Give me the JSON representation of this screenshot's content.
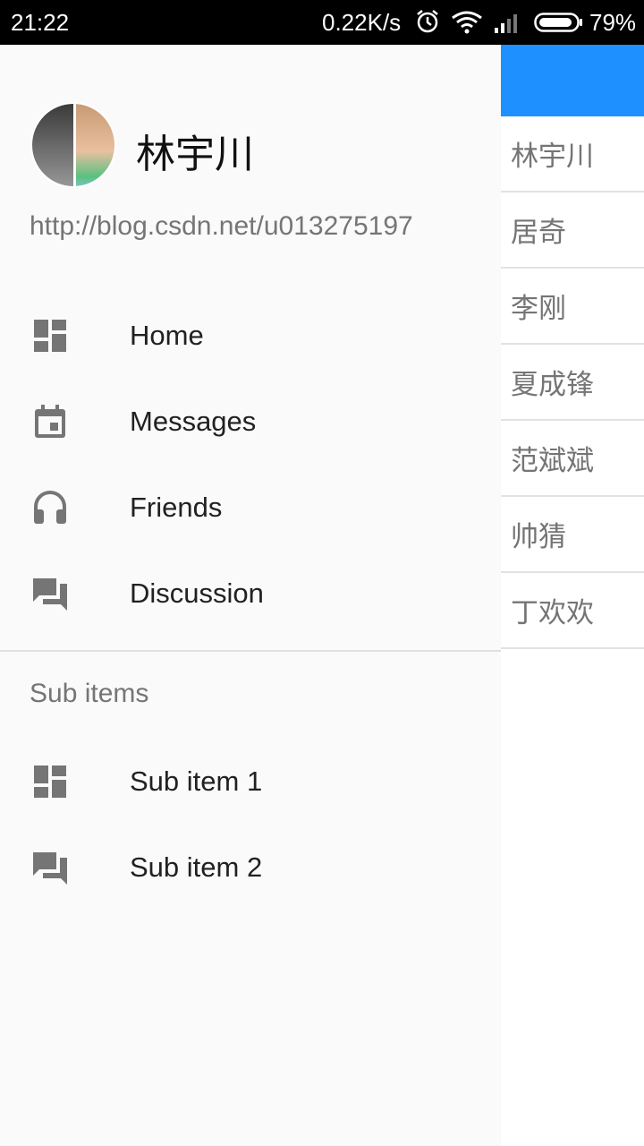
{
  "status_bar": {
    "time": "21:22",
    "net_speed": "0.22K/s",
    "battery_percent": "79%",
    "icons": [
      "alarm-icon",
      "wifi-icon",
      "signal-icon",
      "battery-icon"
    ]
  },
  "background_app": {
    "toolbar_color": "#1e90ff",
    "list": [
      "林宇川",
      "居奇",
      "李刚",
      "夏成锋",
      "范斌斌",
      "帅猜",
      "丁欢欢"
    ]
  },
  "drawer": {
    "header": {
      "name": "林宇川",
      "url": "http://blog.csdn.net/u013275197"
    },
    "menu": [
      {
        "label": "Home",
        "icon": "dashboard-icon"
      },
      {
        "label": "Messages",
        "icon": "calendar-icon"
      },
      {
        "label": "Friends",
        "icon": "headset-icon"
      },
      {
        "label": "Discussion",
        "icon": "forum-icon"
      }
    ],
    "subheader": "Sub items",
    "sub_menu": [
      {
        "label": "Sub item 1",
        "icon": "dashboard-icon"
      },
      {
        "label": "Sub item 2",
        "icon": "forum-icon"
      }
    ]
  }
}
